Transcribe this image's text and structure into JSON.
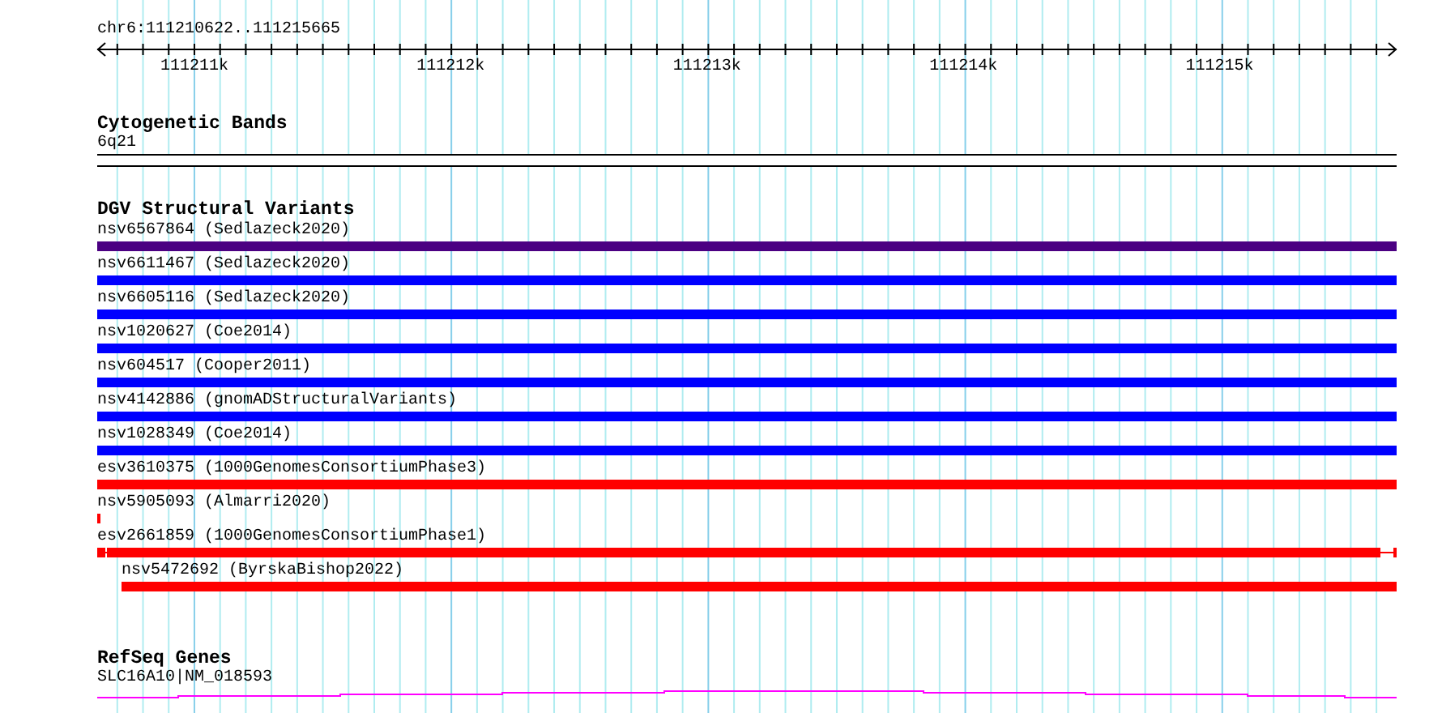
{
  "location": "chr6:111210622..111215665",
  "ruler": {
    "labels": [
      "111211k",
      "111212k",
      "111213k",
      "111214k",
      "111215k"
    ]
  },
  "tracks": [
    {
      "kind": "cytoband",
      "title": "Cytogenetic Bands",
      "features": [
        {
          "label": "6q21"
        }
      ]
    },
    {
      "kind": "variants",
      "title": "DGV Structural Variants",
      "features": [
        {
          "label": "nsv6567864 (Sedlazeck2020)",
          "color": "#4b0082",
          "kind": "bar"
        },
        {
          "label": "nsv6611467 (Sedlazeck2020)",
          "color": "#0000ff",
          "kind": "bar"
        },
        {
          "label": "nsv6605116 (Sedlazeck2020)",
          "color": "#0000ff",
          "kind": "bar"
        },
        {
          "label": "nsv1020627 (Coe2014)",
          "color": "#0000ff",
          "kind": "bar"
        },
        {
          "label": "nsv604517 (Cooper2011)",
          "color": "#0000ff",
          "kind": "bar"
        },
        {
          "label": "nsv4142886 (gnomADStructuralVariants)",
          "color": "#0000ff",
          "kind": "bar"
        },
        {
          "label": "nsv1028349 (Coe2014)",
          "color": "#0000ff",
          "kind": "bar"
        },
        {
          "label": "esv3610375 (1000GenomesConsortiumPhase3)",
          "color": "#ff0000",
          "kind": "bar"
        },
        {
          "label": "nsv5905093 (Almarri2020)",
          "color": "#ff0000",
          "kind": "tick"
        },
        {
          "label": "esv2661859 (1000GenomesConsortiumPhase1)",
          "color": "#ff0000",
          "kind": "capped"
        },
        {
          "label": "nsv5472692 (ByrskaBishop2022)",
          "color": "#ff0000",
          "kind": "indented"
        }
      ]
    },
    {
      "kind": "genes",
      "title": "RefSeq Genes",
      "features": [
        {
          "label": "SLC16A10|NM_018593"
        }
      ]
    }
  ]
}
